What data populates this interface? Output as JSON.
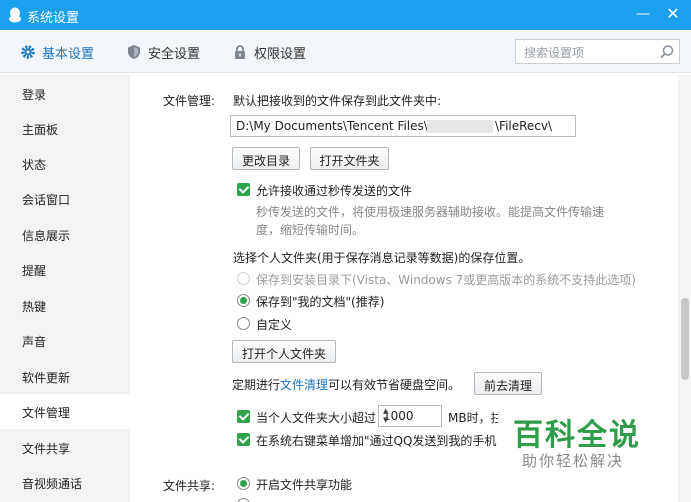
{
  "window": {
    "title": "系统设置",
    "minimize_glyph": "—",
    "close_glyph": "✕"
  },
  "tabs": [
    {
      "label": "基本设置",
      "icon": "gear-icon",
      "active": true
    },
    {
      "label": "安全设置",
      "icon": "shield-icon",
      "active": false
    },
    {
      "label": "权限设置",
      "icon": "lock-icon",
      "active": false
    }
  ],
  "search": {
    "placeholder": "搜索设置项"
  },
  "sidebar": {
    "items": [
      {
        "label": "登录"
      },
      {
        "label": "主面板"
      },
      {
        "label": "状态"
      },
      {
        "label": "会话窗口"
      },
      {
        "label": "信息展示"
      },
      {
        "label": "提醒"
      },
      {
        "label": "热键"
      },
      {
        "label": "声音"
      },
      {
        "label": "软件更新"
      },
      {
        "label": "文件管理",
        "active": true
      },
      {
        "label": "文件共享"
      },
      {
        "label": "音视频通话"
      }
    ]
  },
  "file_mgmt": {
    "section_label": "文件管理:",
    "save_desc": "默认把接收到的文件保存到此文件夹中:",
    "path_prefix": "D:\\My Documents\\Tencent Files\\",
    "path_suffix": "\\FileRecv\\",
    "change_dir_button": "更改目录",
    "open_folder_button": "打开文件夹",
    "allow_flash_label": "允许接收通过秒传发送的文件",
    "allow_flash_desc_1": "秒传发送的文件，将使用极速服务器辅助接收。能提高文件传输速",
    "allow_flash_desc_2": "度，缩短传输时间。",
    "personal_folder_title": "选择个人文件夹(用于保存消息记录等数据)的保存位置。",
    "radio_install_dir": "保存到安装目录下(Vista、Windows 7或更高版本的系统不支持此选项)",
    "radio_my_docs": "保存到\"我的文档\"(推荐)",
    "radio_custom": "自定义",
    "open_personal_folder_button": "打开个人文件夹",
    "cleanup_prefix": "定期进行",
    "cleanup_link": "文件清理",
    "cleanup_suffix": "可以有效节省硬盘空间。",
    "cleanup_button": "前去清理",
    "size_limit_label": "当个人文件夹大小超过",
    "size_limit_value": "1000",
    "size_limit_unit": "MB时，拄",
    "context_menu_label": "在系统右键菜单增加\"通过QQ发送到我的手机"
  },
  "file_share": {
    "section_label": "文件共享:",
    "enable_label": "开启文件共享功能"
  },
  "watermark": {
    "brand": "百科全说",
    "tagline": "助你轻松解决"
  },
  "colors": {
    "titlebar": "#1aa0ed",
    "accent": "#1b76c2",
    "check_green": "#2ea34a"
  }
}
